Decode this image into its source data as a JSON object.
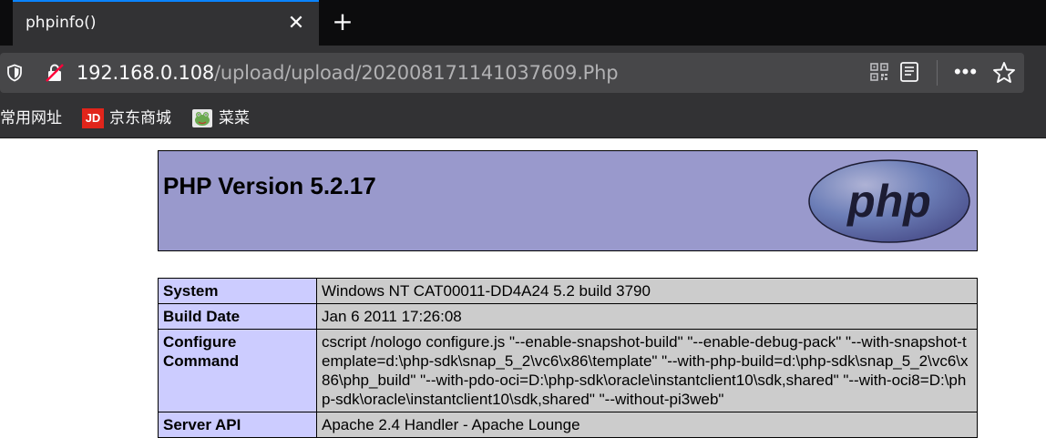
{
  "browser": {
    "tab": {
      "title": "phpinfo()"
    },
    "url": {
      "host": "192.168.0.108",
      "path": "/upload/upload/202008171141037609.Php"
    },
    "bookmarks": [
      {
        "label": "常用网址"
      },
      {
        "label": "京东商城",
        "icon": "jd-icon",
        "icon_text": "JD"
      },
      {
        "label": "菜菜",
        "icon": "frog-icon"
      }
    ]
  },
  "page": {
    "title": "PHP Version 5.2.17",
    "logo_text": "php",
    "rows": [
      {
        "key": "System",
        "value": "Windows NT CAT00011-DD4A24 5.2 build 3790"
      },
      {
        "key": "Build Date",
        "value": "Jan 6 2011 17:26:08"
      },
      {
        "key": "Configure Command",
        "value": "cscript /nologo configure.js \"--enable-snapshot-build\" \"--enable-debug-pack\" \"--with-snapshot-template=d:\\php-sdk\\snap_5_2\\vc6\\x86\\template\" \"--with-php-build=d:\\php-sdk\\snap_5_2\\vc6\\x86\\php_build\" \"--with-pdo-oci=D:\\php-sdk\\oracle\\instantclient10\\sdk,shared\" \"--with-oci8=D:\\php-sdk\\oracle\\instantclient10\\sdk,shared\" \"--without-pi3web\""
      },
      {
        "key": "Server API",
        "value": "Apache 2.4 Handler - Apache Lounge"
      }
    ]
  },
  "colors": {
    "header_bg": "#9999cc",
    "key_bg": "#ccccff",
    "value_bg": "#cccccc",
    "tab_accent": "#0a84ff"
  }
}
